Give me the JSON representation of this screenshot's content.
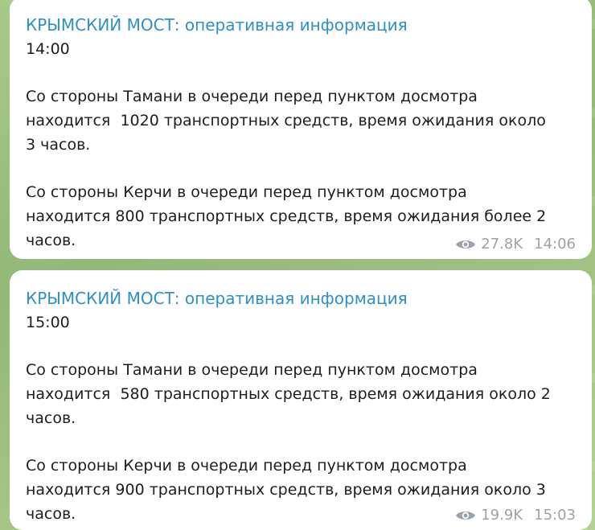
{
  "messages": [
    {
      "channel": "КРЫМСКИЙ МОСТ: оперативная информация",
      "time_header": "14:00",
      "para1": [
        "Со стороны Тамани в очереди перед пунктом досмотра",
        "находится  1020 транспортных средств, время ожидания около",
        "3 часов."
      ],
      "para2": [
        "Со стороны Керчи в очереди перед пунктом досмотра",
        "находится 800 транспортных средств, время ожидания более 2",
        "часов."
      ],
      "views": "27.8K",
      "post_time": "14:06"
    },
    {
      "channel": "КРЫМСКИЙ МОСТ: оперативная информация",
      "time_header": "15:00",
      "para1": [
        "Со стороны Тамани в очереди перед пунктом досмотра",
        "находится  580 транспортных средств, время ожидания около 2",
        "часов."
      ],
      "para2": [
        "Со стороны Керчи в очереди перед пунктом досмотра",
        "находится 900 транспортных средств, время ожидания около 3",
        "часов."
      ],
      "views": "19.9K",
      "post_time": "15:03"
    }
  ],
  "colors": {
    "channel_name": "#2f8fc7",
    "text": "#1d1d1d",
    "meta": "#9aa3ad",
    "background": "#a6c486",
    "bubble": "#ffffff"
  },
  "icons": {
    "views": "eye-icon"
  }
}
